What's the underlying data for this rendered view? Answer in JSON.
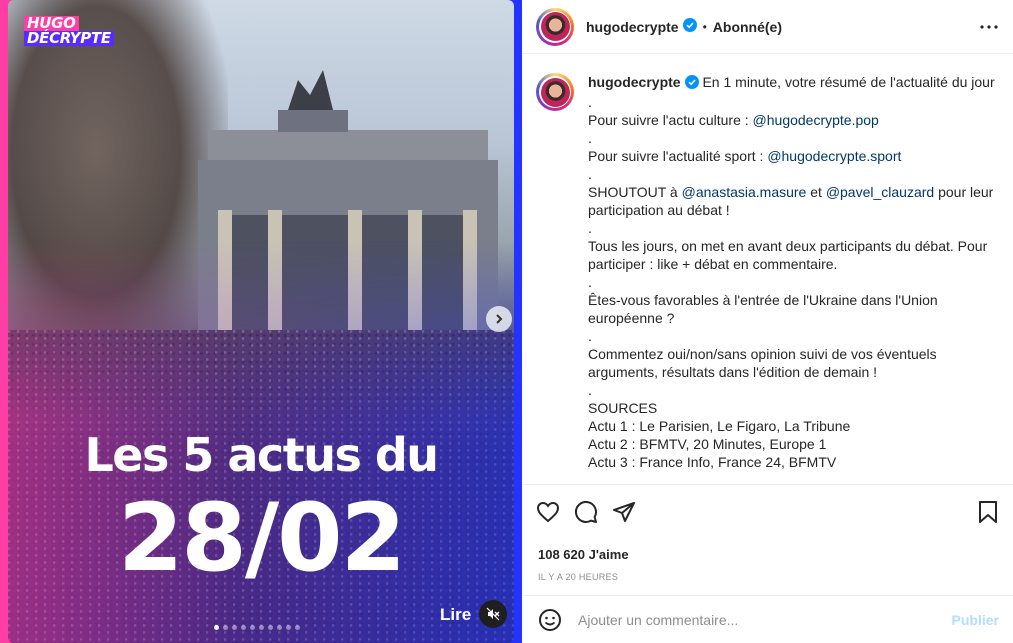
{
  "media": {
    "logo_line1": "HUGO",
    "logo_line2": "DÉCRYPTE",
    "headline_line1": "Les 5 actus du",
    "headline_line2": "28/02",
    "lire_label": "Lire",
    "slide_count": 10,
    "active_slide": 1
  },
  "header": {
    "username": "hugodecrypte",
    "separator": "•",
    "follow_status": "Abonné(e)"
  },
  "caption": {
    "username": "hugodecrypte",
    "lines": [
      {
        "type": "mixed",
        "parts": [
          {
            "t": "text",
            "v": " En 1 minute, votre résumé de l'actualité du jour "
          }
        ]
      },
      {
        "type": "dot",
        "v": "."
      },
      {
        "type": "mixed",
        "parts": [
          {
            "t": "text",
            "v": " Pour suivre l'actu culture : "
          },
          {
            "t": "link",
            "v": "@hugodecrypte.pop"
          }
        ]
      },
      {
        "type": "dot",
        "v": "."
      },
      {
        "type": "mixed",
        "parts": [
          {
            "t": "text",
            "v": " Pour suivre l'actualité sport : "
          },
          {
            "t": "link",
            "v": "@hugodecrypte.sport"
          }
        ]
      },
      {
        "type": "dot",
        "v": "."
      },
      {
        "type": "mixed",
        "parts": [
          {
            "t": "text",
            "v": "SHOUTOUT à "
          },
          {
            "t": "link",
            "v": "@anastasia.masure"
          },
          {
            "t": "text",
            "v": " et "
          },
          {
            "t": "link",
            "v": "@pavel_clauzard"
          },
          {
            "t": "text",
            "v": " pour leur participation au débat !"
          }
        ]
      },
      {
        "type": "dot",
        "v": "."
      },
      {
        "type": "mixed",
        "parts": [
          {
            "t": "text",
            "v": "Tous les jours, on met en avant deux participants du débat. Pour participer : like + débat en commentaire."
          }
        ]
      },
      {
        "type": "dot",
        "v": "."
      },
      {
        "type": "mixed",
        "parts": [
          {
            "t": "text",
            "v": "Êtes-vous favorables à l'entrée de l'Ukraine dans l'Union européenne ? "
          }
        ]
      },
      {
        "type": "dot",
        "v": "."
      },
      {
        "type": "mixed",
        "parts": [
          {
            "t": "text",
            "v": "Commentez oui/non/sans opinion suivi de vos éventuels arguments, résultats dans l'édition de demain !"
          }
        ]
      },
      {
        "type": "dot",
        "v": "."
      },
      {
        "type": "mixed",
        "parts": [
          {
            "t": "text",
            "v": "SOURCES"
          }
        ]
      },
      {
        "type": "mixed",
        "parts": [
          {
            "t": "text",
            "v": "Actu 1 : Le Parisien, Le Figaro, La Tribune"
          }
        ]
      },
      {
        "type": "mixed",
        "parts": [
          {
            "t": "text",
            "v": "Actu 2 : BFMTV, 20 Minutes, Europe 1"
          }
        ]
      },
      {
        "type": "mixed",
        "parts": [
          {
            "t": "text",
            "v": "Actu 3 : France Info, France 24, BFMTV"
          }
        ]
      }
    ]
  },
  "stats": {
    "likes": "108 620 J'aime",
    "time": "IL Y A 20 HEURES"
  },
  "comment": {
    "placeholder": "Ajouter un commentaire...",
    "publish": "Publier"
  },
  "icons": {
    "verified": "verified-badge-icon",
    "more": "more-icon",
    "like": "heart-icon",
    "comment": "comment-icon",
    "share": "share-icon",
    "save": "bookmark-icon",
    "emoji": "emoji-icon",
    "mute": "mute-icon",
    "next": "chevron-right-icon"
  },
  "colors": {
    "verified": "#0095f6",
    "link": "#00376b",
    "publish": "#b2dffc",
    "brand_pink": "#ff3ea5",
    "brand_blue": "#2433ff"
  }
}
